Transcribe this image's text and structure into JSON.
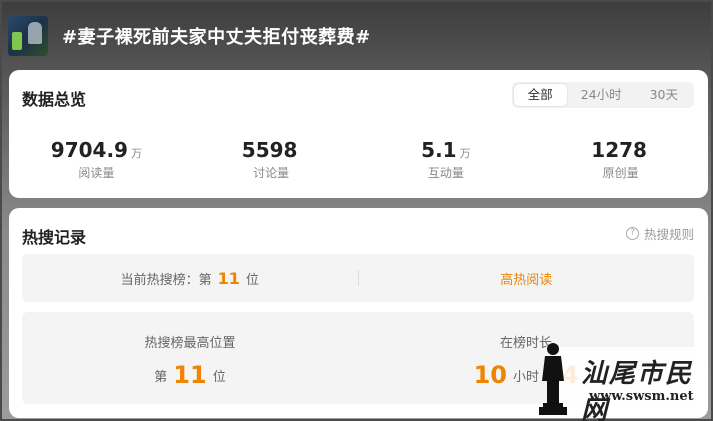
{
  "topic": {
    "title": "#妻子裸死前夫家中丈夫拒付丧葬费#"
  },
  "overview": {
    "title": "数据总览",
    "tabs": [
      {
        "label": "全部",
        "active": true
      },
      {
        "label": "24小时",
        "active": false
      },
      {
        "label": "30天",
        "active": false
      }
    ],
    "stats": [
      {
        "value": "9704.9",
        "unit": "万",
        "label": "阅读量"
      },
      {
        "value": "5598",
        "unit": "",
        "label": "讨论量"
      },
      {
        "value": "5.1",
        "unit": "万",
        "label": "互动量"
      },
      {
        "value": "1278",
        "unit": "",
        "label": "原创量"
      }
    ]
  },
  "hot": {
    "title": "热搜记录",
    "rules_label": "热搜规则",
    "current": {
      "prefix": "当前热搜榜：第",
      "rank": "11",
      "suffix": "位",
      "link": "高热阅读"
    },
    "best": {
      "label": "热搜榜最高位置",
      "prefix": "第",
      "rank": "11",
      "suffix": "位"
    },
    "duration": {
      "label": "在榜时长",
      "hours": "10",
      "hours_unit": "小时",
      "minutes": "54"
    }
  },
  "watermark": {
    "text": "汕尾市民网",
    "url": "www.swsm.net"
  },
  "colors": {
    "accent": "#f08300"
  }
}
